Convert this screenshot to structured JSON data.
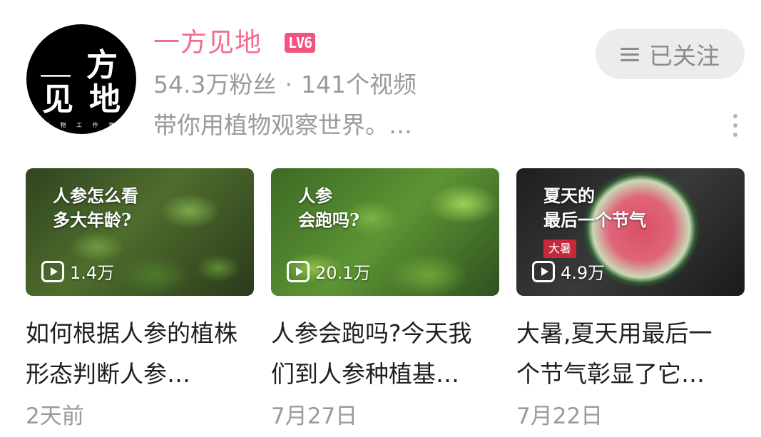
{
  "profile": {
    "avatar": {
      "chars": [
        "一",
        "方",
        "见",
        "地"
      ],
      "subtitle": "植 物 工 作 室"
    },
    "name": "一方见地",
    "level": "LV6",
    "fans": "54.3万粉丝",
    "separator": "·",
    "video_count": "141个视频",
    "bio": "带你用植物观察世界。…",
    "follow_label": "已关注",
    "colors": {
      "name": "#f26d8e",
      "level_badge": "#f0557f",
      "follow_bg": "#ececec"
    }
  },
  "videos": [
    {
      "thumb_title": "人参怎么看\n多大年龄?",
      "thumb_tag": "",
      "views": "1.4万",
      "title": "如何根据人参的植株形态判断人参…",
      "date": "2天前"
    },
    {
      "thumb_title": "人参\n会跑吗?",
      "thumb_tag": "",
      "views": "20.1万",
      "title": "人参会跑吗?今天我们到人参种植基…",
      "date": "7月27日"
    },
    {
      "thumb_title": "夏天的\n最后一个节气",
      "thumb_tag": "大暑",
      "views": "4.9万",
      "title": "大暑,夏天用最后一个节气彰显了它…",
      "date": "7月22日"
    }
  ],
  "icons": {
    "follow": "menu-lines-icon",
    "more": "more-vertical-icon",
    "play": "play-icon"
  }
}
